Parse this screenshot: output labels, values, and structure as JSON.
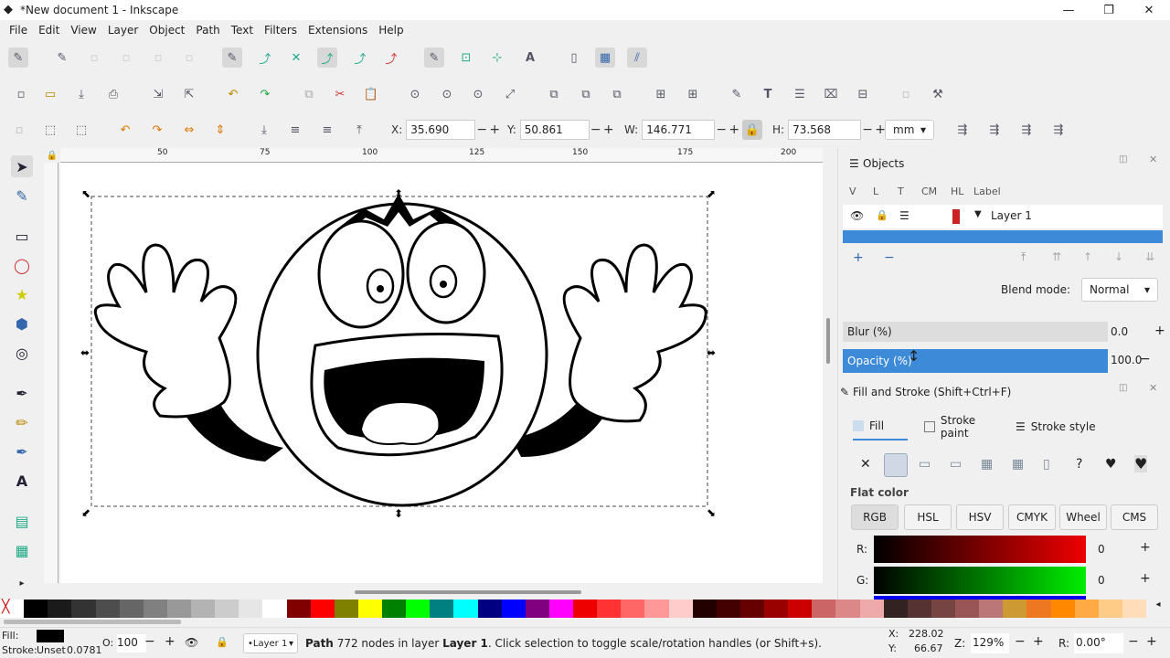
{
  "window": {
    "title": "*New document 1 - Inkscape",
    "min_icon": "minimize-icon",
    "max_icon": "restore-icon",
    "close_icon": "close-icon"
  },
  "menu": [
    "File",
    "Edit",
    "View",
    "Layer",
    "Object",
    "Path",
    "Text",
    "Filters",
    "Extensions",
    "Help"
  ],
  "toolbar_select": {
    "x_label": "X:",
    "x_value": "35.690",
    "y_label": "Y:",
    "y_value": "50.861",
    "w_label": "W:",
    "w_value": "146.771",
    "h_label": "H:",
    "h_value": "73.568",
    "unit": "mm"
  },
  "ruler_ticks": [
    "50",
    "75",
    "100",
    "125",
    "150",
    "175",
    "200"
  ],
  "objects_panel": {
    "title": "Objects",
    "columns": [
      "V",
      "L",
      "T",
      "CM",
      "HL",
      "Label"
    ],
    "layer_label": "Layer 1",
    "blend_label": "Blend mode:",
    "blend_value": "Normal",
    "blur_label": "Blur (%)",
    "blur_value": "0.0",
    "opacity_label": "Opacity (%)",
    "opacity_value": "100.0",
    "opacity_fill": 1.0,
    "layer_highlight_color": "#cc2222"
  },
  "fill_stroke": {
    "title": "Fill and Stroke (Shift+Ctrl+F)",
    "tabs": [
      "Fill",
      "Stroke paint",
      "Stroke style"
    ],
    "flat_color_label": "Flat color",
    "modes": [
      "RGB",
      "HSL",
      "HSV",
      "CMYK",
      "Wheel",
      "CMS"
    ],
    "active_mode": "RGB",
    "r_label": "R:",
    "r_value": "0",
    "g_label": "G:",
    "g_value": "0",
    "accent": "#3c8ad8"
  },
  "status": {
    "fill_label": "Fill:",
    "stroke_label": "Stroke:",
    "stroke_value": "Unset",
    "stroke_width": "0.0781",
    "o_label": "O:",
    "o_value": "100",
    "layer_select": "•Layer 1",
    "message_bold": "Path",
    "message": "772 nodes in layer",
    "message_layer": "Layer 1",
    "message_tail": ". Click selection to toggle scale/rotation handles (or Shift+s).",
    "x_label": "X:",
    "x_value": "228.02",
    "y_label": "Y:",
    "y_value": "66.67",
    "z_label": "Z:",
    "zoom": "129%",
    "r_label": "R:",
    "rotation": "0.00°"
  }
}
